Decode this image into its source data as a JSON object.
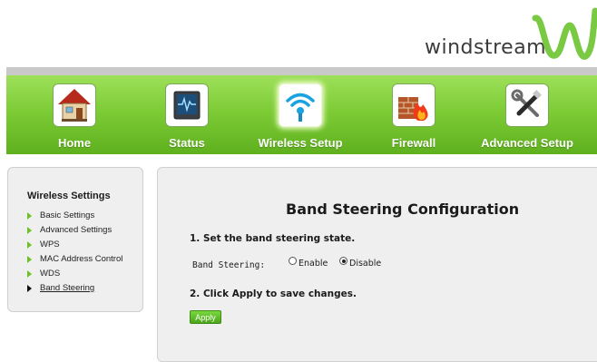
{
  "brand": {
    "name": "windstream",
    "accent": "#6cc02c",
    "wave_color": "#7ac943"
  },
  "nav": {
    "items": [
      {
        "label": "Home",
        "icon": "home-icon"
      },
      {
        "label": "Status",
        "icon": "status-monitor-icon"
      },
      {
        "label": "Wireless Setup",
        "icon": "wireless-icon",
        "active": true
      },
      {
        "label": "Firewall",
        "icon": "firewall-icon"
      },
      {
        "label": "Advanced Setup",
        "icon": "tools-icon"
      }
    ]
  },
  "sidebar": {
    "title": "Wireless Settings",
    "items": [
      {
        "label": "Basic Settings"
      },
      {
        "label": "Advanced Settings"
      },
      {
        "label": "WPS"
      },
      {
        "label": "MAC Address Control"
      },
      {
        "label": "WDS"
      },
      {
        "label": "Band Steering",
        "current": true
      }
    ]
  },
  "main": {
    "title": "Band Steering Configuration",
    "step1": "1. Set the band steering state.",
    "field_label": "Band Steering:",
    "options": [
      {
        "label": "Enable",
        "checked": false
      },
      {
        "label": "Disable",
        "checked": true
      }
    ],
    "step2": "2. Click Apply to save changes.",
    "apply_label": "Apply"
  }
}
